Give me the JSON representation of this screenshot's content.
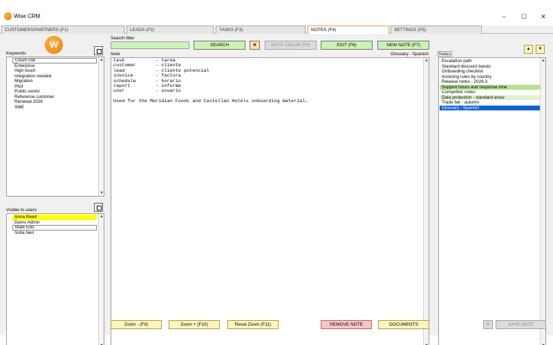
{
  "window": {
    "title": "Wise CRM",
    "min_label": "–",
    "max_label": "☐",
    "close_label": "✕"
  },
  "tabs": [
    {
      "label": "CUSTOMERS/PARTNERS (F1)"
    },
    {
      "label": "LEADS (F2)"
    },
    {
      "label": "TASKS (F3)"
    },
    {
      "label": "NOTES (F4)"
    },
    {
      "label": "SETTINGS (F5)"
    }
  ],
  "logo": {
    "text": "W"
  },
  "keywords": {
    "label": "Keywords",
    "items": [
      "Churn risk",
      "Enterprise",
      "High touch",
      "Integration needed",
      "Migration",
      "Pilot",
      "Public sector",
      "Reference customer",
      "Renewal 2026",
      "SME"
    ]
  },
  "visible_users": {
    "label": "Visible to users",
    "items": [
      {
        "name": "Anna Reed",
        "highlight": "#ffff00"
      },
      {
        "name": "Demo Admin",
        "highlight": ""
      },
      {
        "name": "Mark Ellis",
        "highlight": ""
      },
      {
        "name": "Sofia Neri",
        "highlight": ""
      }
    ]
  },
  "search": {
    "label": "Search filter",
    "value": "",
    "search_button": "SEARCH",
    "clear_button": "✕",
    "note_color_button": "NOTE COLOR (F8)",
    "edit_button": "EDIT (F6)",
    "new_note_button": "NEW NOTE (F7)"
  },
  "note": {
    "label": "Note",
    "current_title": "Glossary - Spanish",
    "content": "task           - tarea\ncustomer       - cliente\nlead           - cliente potencial\ninvoice        - factura\nschedule       - horario\nreport         - informe\nuser           - usuario\n\nUsed for the Meridian Foods and Castellan Hotels onboarding material."
  },
  "notes_list": {
    "label": "Notes",
    "up_label": "▲",
    "down_label": "▼",
    "items": [
      {
        "title": "Escalation path",
        "bg": "",
        "selected": false
      },
      {
        "title": "Standard discount bands",
        "bg": "",
        "selected": false
      },
      {
        "title": "Onboarding checklist",
        "bg": "",
        "selected": false
      },
      {
        "title": "Invoicing rules by country",
        "bg": "",
        "selected": false
      },
      {
        "title": "Release notes - 2026.3",
        "bg": "",
        "selected": false
      },
      {
        "title": "Support hours and response time",
        "bg": "#b4e38a",
        "selected": false
      },
      {
        "title": "Competitor notes",
        "bg": "",
        "selected": false
      },
      {
        "title": "Data protection - standard answ",
        "bg": "#dff2cc",
        "selected": false
      },
      {
        "title": "Trade fair - autumn",
        "bg": "",
        "selected": false
      },
      {
        "title": "Glossary - Spanish",
        "bg": "#0a64d4",
        "selected": true
      }
    ]
  },
  "footer": {
    "zoom_out": "Zoom - (F9)",
    "zoom_in": "Zoom + (F10)",
    "reset_zoom": "Reset Zoom (F11)",
    "remove_note": "REMOVE NOTE",
    "documents": "DOCUMENTS",
    "cancel": "✕",
    "save_note": "SAVE NOTE"
  },
  "colors": {
    "accent_orange": "#f07800",
    "button_green": "#c9f5b4",
    "button_yellow": "#fff5b8",
    "button_pink": "#ffc3c3",
    "selection_blue": "#0a64d4"
  }
}
